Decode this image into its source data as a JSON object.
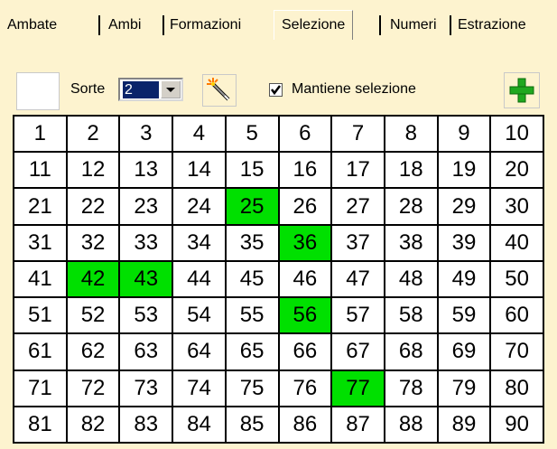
{
  "tabs": [
    {
      "label": "Ambate"
    },
    {
      "label": "Ambi"
    },
    {
      "label": "Formazioni"
    },
    {
      "label": "Selezione",
      "active": true
    },
    {
      "label": "Numeri"
    },
    {
      "label": "Estrazione"
    }
  ],
  "toolbar": {
    "sorte_label": "Sorte",
    "sorte_value": "2",
    "checkbox_label": "Mantiene selezione",
    "checkbox_checked": true
  },
  "grid": {
    "numbers": [
      "1",
      "2",
      "3",
      "4",
      "5",
      "6",
      "7",
      "8",
      "9",
      "10",
      "11",
      "12",
      "13",
      "14",
      "15",
      "16",
      "17",
      "18",
      "19",
      "20",
      "21",
      "22",
      "23",
      "24",
      "25",
      "26",
      "27",
      "28",
      "29",
      "30",
      "31",
      "32",
      "33",
      "34",
      "35",
      "36",
      "37",
      "38",
      "39",
      "40",
      "41",
      "42",
      "43",
      "44",
      "45",
      "46",
      "47",
      "48",
      "49",
      "50",
      "51",
      "52",
      "53",
      "54",
      "55",
      "56",
      "57",
      "58",
      "59",
      "60",
      "61",
      "62",
      "63",
      "64",
      "65",
      "66",
      "67",
      "68",
      "69",
      "70",
      "71",
      "72",
      "73",
      "74",
      "75",
      "76",
      "77",
      "78",
      "79",
      "80",
      "81",
      "82",
      "83",
      "84",
      "85",
      "86",
      "87",
      "88",
      "89",
      "90"
    ],
    "selected": [
      "25",
      "36",
      "42",
      "43",
      "56",
      "77"
    ],
    "selected_color": "#00e000"
  },
  "icons": {
    "wand": "magic-wand-icon",
    "add": "plus-icon"
  }
}
